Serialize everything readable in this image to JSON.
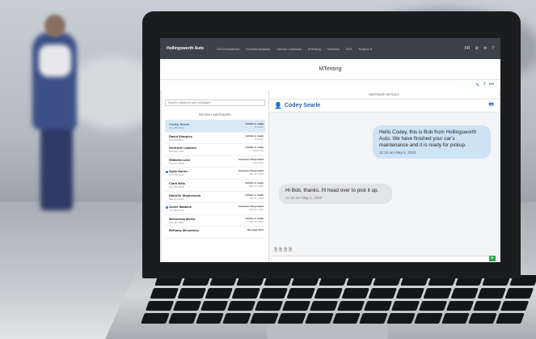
{
  "nav": {
    "brand": "Hollingsworth Auto",
    "links": [
      "OSO4 Business",
      "Communications",
      "Service Calendar",
      "MTexting",
      "Reviews",
      "ROI",
      "Toolbox ▾"
    ],
    "lang": "FR"
  },
  "page": {
    "title": "MTexting"
  },
  "left": {
    "search_placeholder": "Search customers and messages...",
    "recent_header": "RECENT MESSAGES",
    "conversations": [
      {
        "name": "Codey Searle",
        "phone": "251-288-8901",
        "status": "Vehicle is ready",
        "date": "11:15am",
        "unread": false,
        "active": true
      },
      {
        "name": "David Sharples",
        "phone": "251-555-0224",
        "status": "Vehicle is ready",
        "date": "10:21am",
        "unread": false,
        "active": false
      },
      {
        "name": "Gertrude Lambert",
        "phone": "535-345-1937",
        "status": "Vehicle is ready",
        "date": "Yesterday",
        "unread": false,
        "active": false
      },
      {
        "name": "Wiktoria Lane",
        "phone": "812-621-0040",
        "status": "Customer Responded",
        "date": "Yesterday",
        "unread": false,
        "active": false
      },
      {
        "name": "Ayub Nunez",
        "phone": "075-790-2123",
        "status": "Customer Responded",
        "date": "Mar 23, 2020",
        "unread": true,
        "active": false
      },
      {
        "name": "Clark Mills",
        "phone": "215-785-6648",
        "status": "Vehicle is ready",
        "date": "Mar 23, 2020",
        "unread": false,
        "active": false
      },
      {
        "name": "Danielle Stephenson",
        "phone": "080-201-4021",
        "status": "Vehicle is ready",
        "date": "Mar 21, 2020",
        "unread": false,
        "active": false
      },
      {
        "name": "Javier Watkins",
        "phone": "771-350-6778",
        "status": "Customer Responded",
        "date": "Mar 06, 2020",
        "unread": true,
        "active": false
      },
      {
        "name": "Morwenna Mellor",
        "phone": "904-281-0951",
        "status": "Vehicle is ready",
        "date": "Mar 06, 2020",
        "unread": false,
        "active": false
      },
      {
        "name": "Bethany Mccartney",
        "phone": "",
        "status": "Message Sent",
        "date": "",
        "unread": false,
        "active": false
      }
    ]
  },
  "right": {
    "details_header": "MESSAGE DETAILS",
    "contact_name": "Codey Searle",
    "messages": [
      {
        "direction": "out",
        "text": "Hello Codey, this is Bob from Hollingsworth Auto. We have finished your car's maintenance and it is ready for pickup.",
        "time": "11:15 am  May 5, 2020"
      },
      {
        "direction": "in",
        "text": "Hi Bob, thanks. I'll head over to pick it up.",
        "time": "11:16 am  May 5, 2020"
      }
    ]
  },
  "colors": {
    "accent": "#2a5ea8",
    "nav": "#3d4148",
    "bubble_out": "#cfe3f7",
    "bubble_in": "#e3e4e6",
    "send": "#2aa64a"
  }
}
